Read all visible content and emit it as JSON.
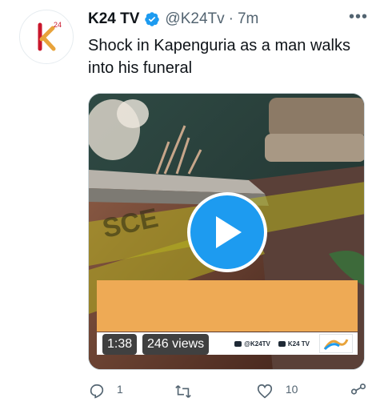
{
  "tweet": {
    "author_name": "K24 TV",
    "handle": "@K24Tv",
    "separator": "·",
    "time": "7m",
    "more_label": "•••",
    "text": "Shock in Kapenguria as a man walks into his funeral",
    "avatar": {
      "logo_text": "k",
      "logo_superscript": "24"
    }
  },
  "media": {
    "duration": "1:38",
    "views": "246 views",
    "overlay_handle": "@K24TV",
    "overlay_channel": "K24 TV",
    "scene_text": "SCE"
  },
  "actions": {
    "reply_count": "1",
    "retweet_count": "",
    "like_count": "10",
    "icons": [
      "reply-icon",
      "retweet-icon",
      "like-icon",
      "share-icon"
    ]
  },
  "colors": {
    "accent": "#1d9bf0",
    "brand_orange": "#e8a33b",
    "brand_red": "#c9162b",
    "text_primary": "#0f1419",
    "text_secondary": "#536471",
    "overlay_bar": "#eeaa55"
  }
}
